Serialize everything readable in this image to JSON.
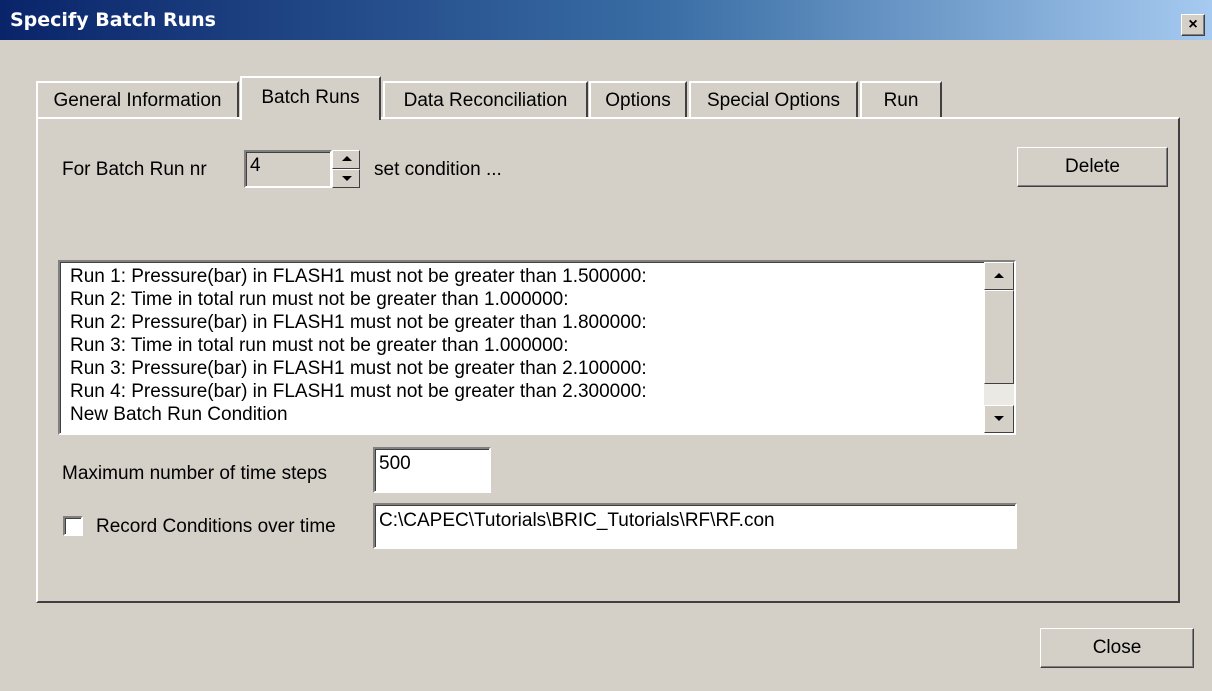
{
  "window": {
    "title": "Specify Batch Runs",
    "close_glyph": "×"
  },
  "tabs": [
    {
      "label": "General Information",
      "active": false
    },
    {
      "label": "Batch Runs",
      "active": true
    },
    {
      "label": "Data Reconciliation",
      "active": false
    },
    {
      "label": "Options",
      "active": false
    },
    {
      "label": "Special Options",
      "active": false
    },
    {
      "label": "Run",
      "active": false
    }
  ],
  "batch_run": {
    "prefix_label": "For Batch Run nr",
    "number": "4",
    "suffix_label": "set condition ...",
    "delete_label": "Delete"
  },
  "conditions": [
    "Run 1: Pressure(bar) in FLASH1 must not be greater than 1.500000:",
    "Run 2: Time in total run must not be greater than 1.000000:",
    "Run 2: Pressure(bar) in FLASH1 must not be greater than 1.800000:",
    "Run 3: Time in total run must not be greater than 1.000000:",
    "Run 3: Pressure(bar) in FLASH1 must not be greater than 2.100000:",
    "Run 4: Pressure(bar) in FLASH1 must not be greater than 2.300000:",
    "New Batch Run Condition"
  ],
  "max_steps": {
    "label": "Maximum number of time steps",
    "value": "500"
  },
  "record": {
    "label": "Record Conditions over time",
    "checked": false,
    "path": "C:\\CAPEC\\Tutorials\\BRIC_Tutorials\\RF\\RF.con"
  },
  "footer": {
    "close_label": "Close"
  }
}
